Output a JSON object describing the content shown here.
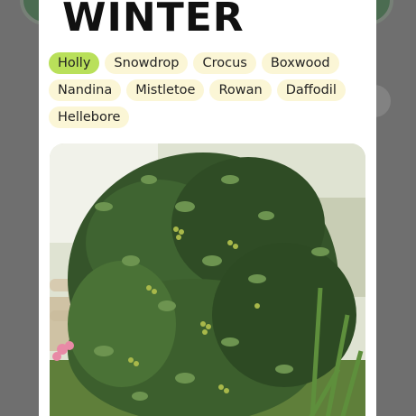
{
  "modal": {
    "title": "WINTER"
  },
  "plants": [
    {
      "label": "Holly",
      "active": true
    },
    {
      "label": "Snowdrop",
      "active": false
    },
    {
      "label": "Crocus",
      "active": false
    },
    {
      "label": "Boxwood",
      "active": false
    },
    {
      "label": "Nandina",
      "active": false
    },
    {
      "label": "Mistletoe",
      "active": false
    },
    {
      "label": "Rowan",
      "active": false
    },
    {
      "label": "Daffodil",
      "active": false
    },
    {
      "label": "Hellebore",
      "active": false
    }
  ],
  "colors": {
    "chip_bg": "#fbf6d6",
    "chip_active_bg": "#b9e05a",
    "overlay": "#6f6f6f"
  },
  "photo": {
    "icon": "holly-shrub-photo"
  }
}
